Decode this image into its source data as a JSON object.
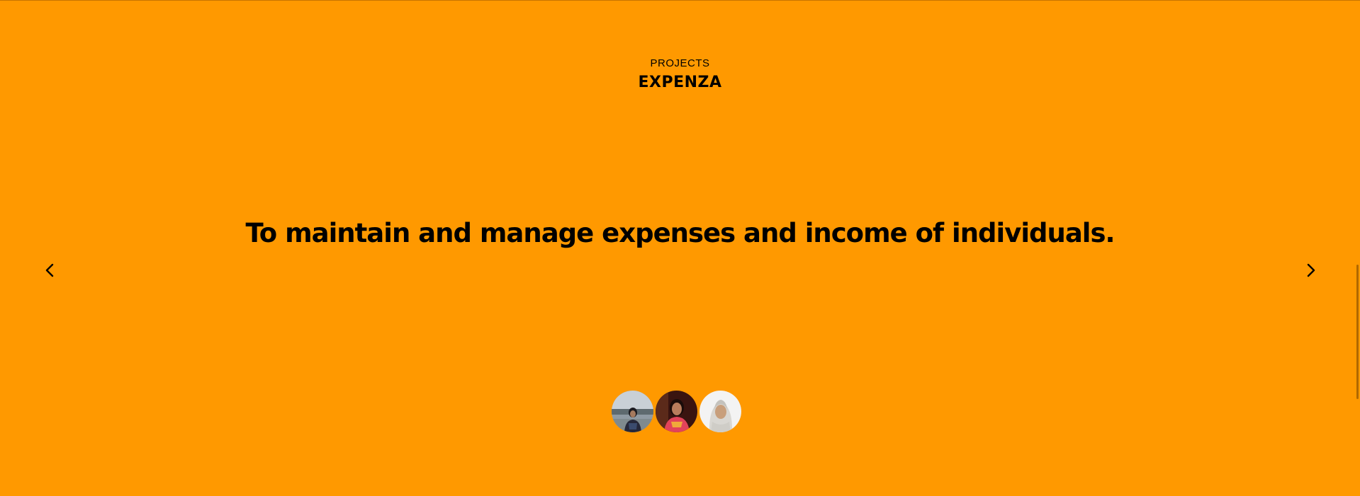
{
  "section": {
    "eyebrow": "PROJECTS",
    "title": "EXPENZA"
  },
  "slide": {
    "tagline": "To maintain and manage expenses and income of individuals."
  },
  "navigation": {
    "prev_icon": "chevron-left-icon",
    "next_icon": "chevron-right-icon"
  },
  "team": {
    "avatars": [
      "avatar-1",
      "avatar-2",
      "avatar-3"
    ]
  },
  "colors": {
    "background": "#ff9900",
    "text": "#000000"
  }
}
